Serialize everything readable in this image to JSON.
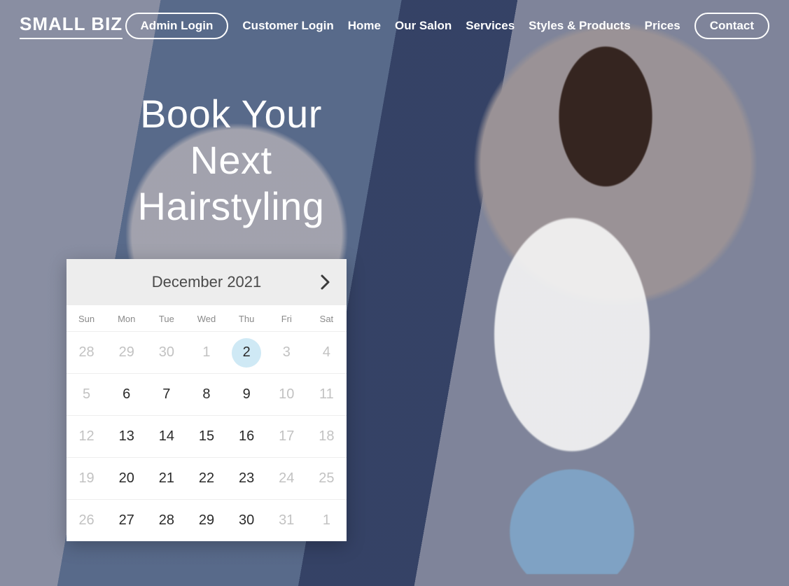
{
  "logo": "SMALL BIZ",
  "nav": {
    "admin_login": "Admin Login",
    "customer_login": "Customer Login",
    "home": "Home",
    "our_salon": "Our Salon",
    "services": "Services",
    "styles_products": "Styles & Products",
    "prices": "Prices",
    "contact": "Contact"
  },
  "headline": {
    "line1": "Book Your",
    "line2": "Next",
    "line3": "Hairstyling"
  },
  "calendar": {
    "title": "December 2021",
    "dow": [
      "Sun",
      "Mon",
      "Tue",
      "Wed",
      "Thu",
      "Fri",
      "Sat"
    ],
    "days": [
      {
        "n": "28",
        "muted": true
      },
      {
        "n": "29",
        "muted": true
      },
      {
        "n": "30",
        "muted": true
      },
      {
        "n": "1",
        "muted": true
      },
      {
        "n": "2",
        "selected": true
      },
      {
        "n": "3",
        "muted": true
      },
      {
        "n": "4",
        "muted": true
      },
      {
        "n": "5",
        "muted": true
      },
      {
        "n": "6"
      },
      {
        "n": "7"
      },
      {
        "n": "8"
      },
      {
        "n": "9"
      },
      {
        "n": "10",
        "muted": true
      },
      {
        "n": "11",
        "muted": true
      },
      {
        "n": "12",
        "muted": true
      },
      {
        "n": "13"
      },
      {
        "n": "14"
      },
      {
        "n": "15"
      },
      {
        "n": "16"
      },
      {
        "n": "17",
        "muted": true
      },
      {
        "n": "18",
        "muted": true
      },
      {
        "n": "19",
        "muted": true
      },
      {
        "n": "20"
      },
      {
        "n": "21"
      },
      {
        "n": "22"
      },
      {
        "n": "23"
      },
      {
        "n": "24",
        "muted": true
      },
      {
        "n": "25",
        "muted": true
      },
      {
        "n": "26",
        "muted": true
      },
      {
        "n": "27"
      },
      {
        "n": "28"
      },
      {
        "n": "29"
      },
      {
        "n": "30"
      },
      {
        "n": "31",
        "muted": true
      },
      {
        "n": "1",
        "muted": true
      }
    ]
  }
}
